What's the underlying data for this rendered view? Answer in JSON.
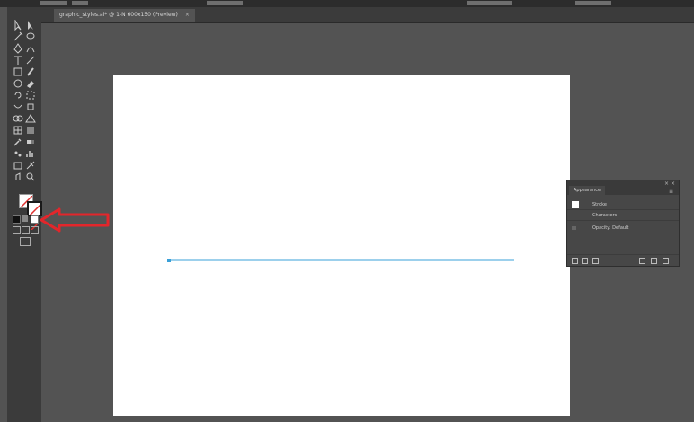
{
  "document_tab": {
    "title": "graphic_styles.ai* @ 1-N 600x150 (Preview)",
    "close_glyph": "×"
  },
  "toolbar": {
    "tools": [
      "selection-icon",
      "direct-selection-icon",
      "magic-wand-icon",
      "lasso-icon",
      "pen-icon",
      "curvature-icon",
      "type-icon",
      "line-segment-icon",
      "rectangle-icon",
      "paintbrush-icon",
      "shaper-icon",
      "eraser-icon",
      "rotate-icon",
      "scale-icon",
      "width-icon",
      "free-transform-icon",
      "shape-builder-icon",
      "perspective-grid-icon",
      "mesh-icon",
      "gradient-icon",
      "eyedropper-icon",
      "blend-icon",
      "symbol-sprayer-icon",
      "column-graph-icon",
      "artboard-icon",
      "slice-icon",
      "hand-icon",
      "zoom-icon"
    ],
    "fill_stroke": {
      "fill_color": "#ffffff",
      "stroke_color": "#1a1a1a",
      "none_indicator": "#e0302f"
    }
  },
  "annotation": {
    "arrow_color": "#e3262b"
  },
  "artboard": {
    "line_color": "#3aa0d8"
  },
  "appearance_panel": {
    "tab_label": "Appearance",
    "menu_glyph": "≡",
    "close_glyph": "× ×",
    "rows": [
      {
        "label": "Stroke"
      },
      {
        "label": "Characters"
      },
      {
        "label": "Opacity: Default"
      }
    ]
  }
}
